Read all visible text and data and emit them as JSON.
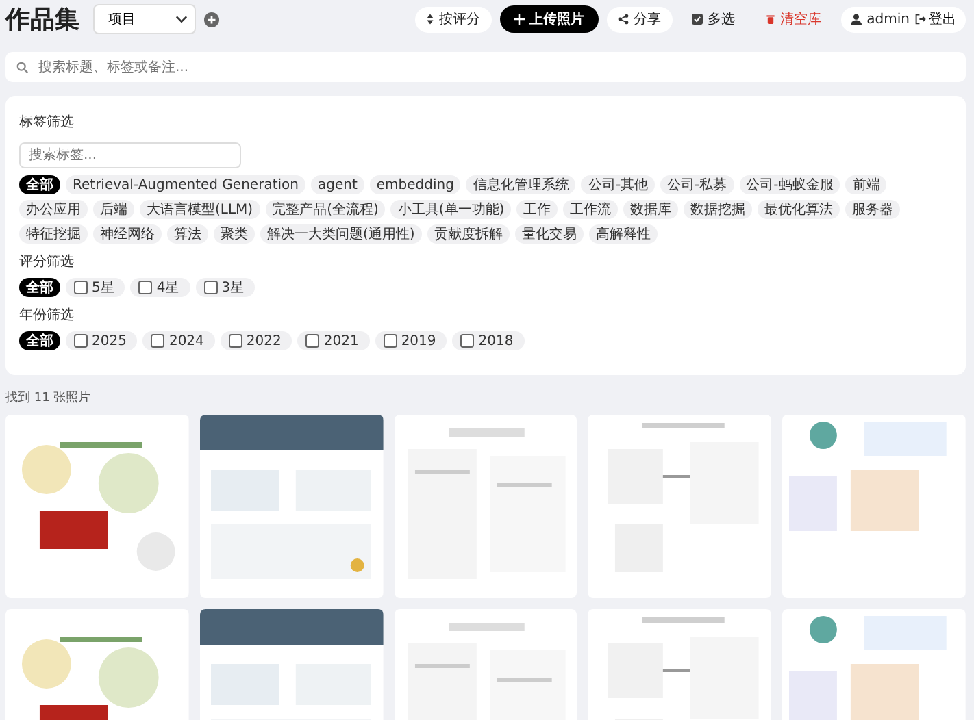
{
  "header": {
    "title": "作品集",
    "project_select": "项目",
    "buttons": [
      {
        "kind": "sort",
        "label": "按评分"
      },
      {
        "kind": "upload",
        "label": "上传照片"
      },
      {
        "kind": "share",
        "label": "分享"
      },
      {
        "kind": "multi",
        "label": "多选"
      },
      {
        "kind": "clear",
        "label": "清空库"
      }
    ],
    "user": "admin",
    "logout": "登出"
  },
  "search": {
    "placeholder": "搜索标题、标签或备注..."
  },
  "tag_filter": {
    "title": "标签筛选",
    "placeholder": "搜索标签...",
    "tags": [
      {
        "label": "全部",
        "selected": true
      },
      {
        "label": "Retrieval-Augmented Generation",
        "selected": false
      },
      {
        "label": "agent",
        "selected": false
      },
      {
        "label": "embedding",
        "selected": false
      },
      {
        "label": "信息化管理系统",
        "selected": false
      },
      {
        "label": "公司-其他",
        "selected": false
      },
      {
        "label": "公司-私募",
        "selected": false
      },
      {
        "label": "公司-蚂蚁金服",
        "selected": false
      },
      {
        "label": "前端",
        "selected": false
      },
      {
        "label": "办公应用",
        "selected": false
      },
      {
        "label": "后端",
        "selected": false
      },
      {
        "label": "大语言模型(LLM)",
        "selected": false
      },
      {
        "label": "完整产品(全流程)",
        "selected": false
      },
      {
        "label": "小工具(单一功能)",
        "selected": false
      },
      {
        "label": "工作",
        "selected": false
      },
      {
        "label": "工作流",
        "selected": false
      },
      {
        "label": "数据库",
        "selected": false
      },
      {
        "label": "数据挖掘",
        "selected": false
      },
      {
        "label": "最优化算法",
        "selected": false
      },
      {
        "label": "服务器",
        "selected": false
      },
      {
        "label": "特征挖掘",
        "selected": false
      },
      {
        "label": "神经网络",
        "selected": false
      },
      {
        "label": "算法",
        "selected": false
      },
      {
        "label": "聚类",
        "selected": false
      },
      {
        "label": "解决一大类问题(通用性)",
        "selected": false
      },
      {
        "label": "贡献度拆解",
        "selected": false
      },
      {
        "label": "量化交易",
        "selected": false
      },
      {
        "label": "高解释性",
        "selected": false
      }
    ]
  },
  "rating_filter": {
    "title": "评分筛选",
    "all": {
      "label": "全部",
      "selected": true
    },
    "options": [
      {
        "label": "5星",
        "checked": false
      },
      {
        "label": "4星",
        "checked": false
      },
      {
        "label": "3星",
        "checked": false
      }
    ]
  },
  "year_filter": {
    "title": "年份筛选",
    "all": {
      "label": "全部",
      "selected": true
    },
    "options": [
      {
        "label": "2025",
        "checked": false
      },
      {
        "label": "2024",
        "checked": false
      },
      {
        "label": "2022",
        "checked": false
      },
      {
        "label": "2021",
        "checked": false
      },
      {
        "label": "2019",
        "checked": false
      },
      {
        "label": "2018",
        "checked": false
      }
    ]
  },
  "result_count": "找到 11 张照片"
}
